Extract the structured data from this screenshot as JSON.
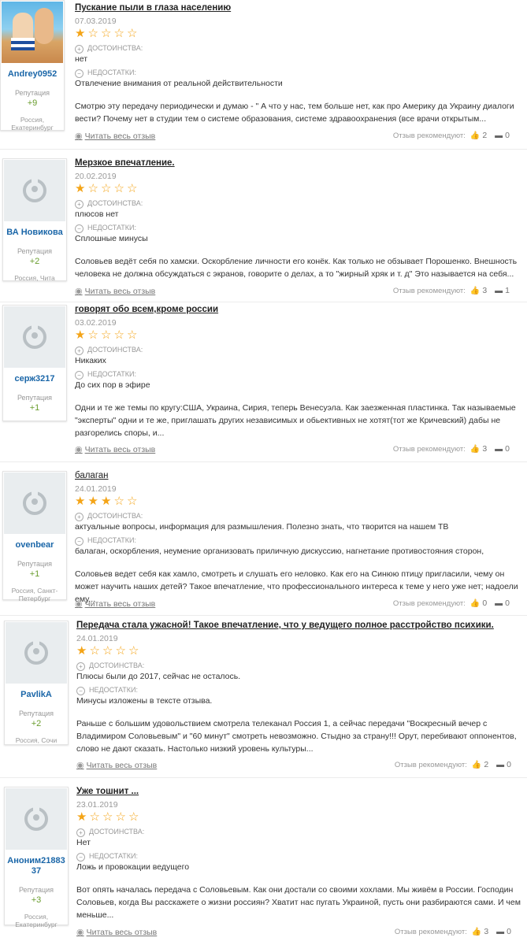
{
  "labels": {
    "pros": "ДОСТОИНСТВА:",
    "cons": "НЕДОСТАТКИ:",
    "read_more": "Читать весь отзыв",
    "recommend": "Отзыв рекомендуют:",
    "reputation": "Репутация"
  },
  "reviews": [
    {
      "username": "Andrey0952",
      "reputation": "+9",
      "location": "Россия, Екатеринбург",
      "title": "Пускание пыли в глаза населению",
      "date": "07.03.2019",
      "rating": 1,
      "pros": "нет",
      "cons": "Отвлечение внимания от реальной действительности",
      "text": "Смотрю эту передачу периодически и думаю - \" А что у нас, тем больше нет, как про Америку да Украину диалоги вести? Почему нет в студии тем о системе образования, системе здравоохранения (все врачи открытым...",
      "likes": "2",
      "comments": "0"
    },
    {
      "username": "ВА Новикова",
      "reputation": "+2",
      "location": "Россия, Чита",
      "title": "Мерзкое впечатление.",
      "date": "20.02.2019",
      "rating": 1,
      "pros": "плюсов нет",
      "cons": "Сплошные минусы",
      "text": "Соловьев ведёт себя по хамски. Оскорбление личности его конёк. Как только не обзывает Порошенко. Внешность человека не должна обсуждаться с экранов, говорите о делах, а то \"жирный хряк и т. д\" Это называется на себя...",
      "likes": "3",
      "comments": "1"
    },
    {
      "username": "серж3217",
      "reputation": "+1",
      "location": "",
      "title": "говорят обо всем,кроме россии",
      "date": "03.02.2019",
      "rating": 1,
      "pros": "Никаких",
      "cons": "До сих пор в эфире",
      "text": "Одни и те же темы по кругу:США, Украина, Сирия, теперь Венесуэла. Как заезженная пластинка. Так называемые \"эксперты\" одни и те же, приглашать других независимых и обьективных не хотят(тот же Кричевский) дабы не разгорелись споры, и...",
      "likes": "3",
      "comments": "0"
    },
    {
      "username": "ovenbear",
      "reputation": "+1",
      "location": "Россия, Санкт-Петербург",
      "title": "балаган",
      "date": "24.01.2019",
      "rating": 3,
      "pros": "актуальные вопросы, информация для размышления. Полезно знать, что творится на нашем ТВ",
      "cons": "балаган, оскорбления, неумение организовать приличную дискуссию, нагнетание противостояния сторон,",
      "text": "Соловьев ведет себя как хамло, смотреть и слушать его неловко. Как его на Синюю птицу пригласили, чему он может научить наших детей? Такое впечатление, что профессионального интереса к теме у него уже нет; надоели ему...",
      "likes": "0",
      "comments": "0"
    },
    {
      "username": "PavlikA",
      "reputation": "+2",
      "location": "Россия, Сочи",
      "title": "Передача стала ужасной! Такое впечатление, что у ведущего полное расстройство психики.",
      "date": "24.01.2019",
      "rating": 1,
      "pros": "Плюсы были до 2017, сейчас не осталось.",
      "cons": "Минусы изложены в тексте отзыва.",
      "text": "Раньше с большим удовольствием смотрела телеканал Россия 1, а сейчас передачи \"Воскресный вечер с Владимиром Соловьевым\" и \"60 минут\" смотреть невозможно. Стыдно за страну!!! Орут, перебивают оппонентов, слово не дают сказать. Настолько низкий уровень культуры...",
      "likes": "2",
      "comments": "0"
    },
    {
      "username": "Аноним2188337",
      "reputation": "+3",
      "location": "Россия, Екатеринбург",
      "title": "Уже тошнит ...",
      "date": "23.01.2019",
      "rating": 1,
      "pros": "Нет",
      "cons": "Ложь и провокации ведущего",
      "text": "Вот опять началась передача с Соловьевым. Как они достали со своими хохлами. Мы живём в России. Господин Соловьев, когда Вы расскажете о жизни россиян? Хватит нас пугать Украиной, пусть они разбираются сами. И чем меньше...",
      "likes": "3",
      "comments": "0"
    }
  ]
}
